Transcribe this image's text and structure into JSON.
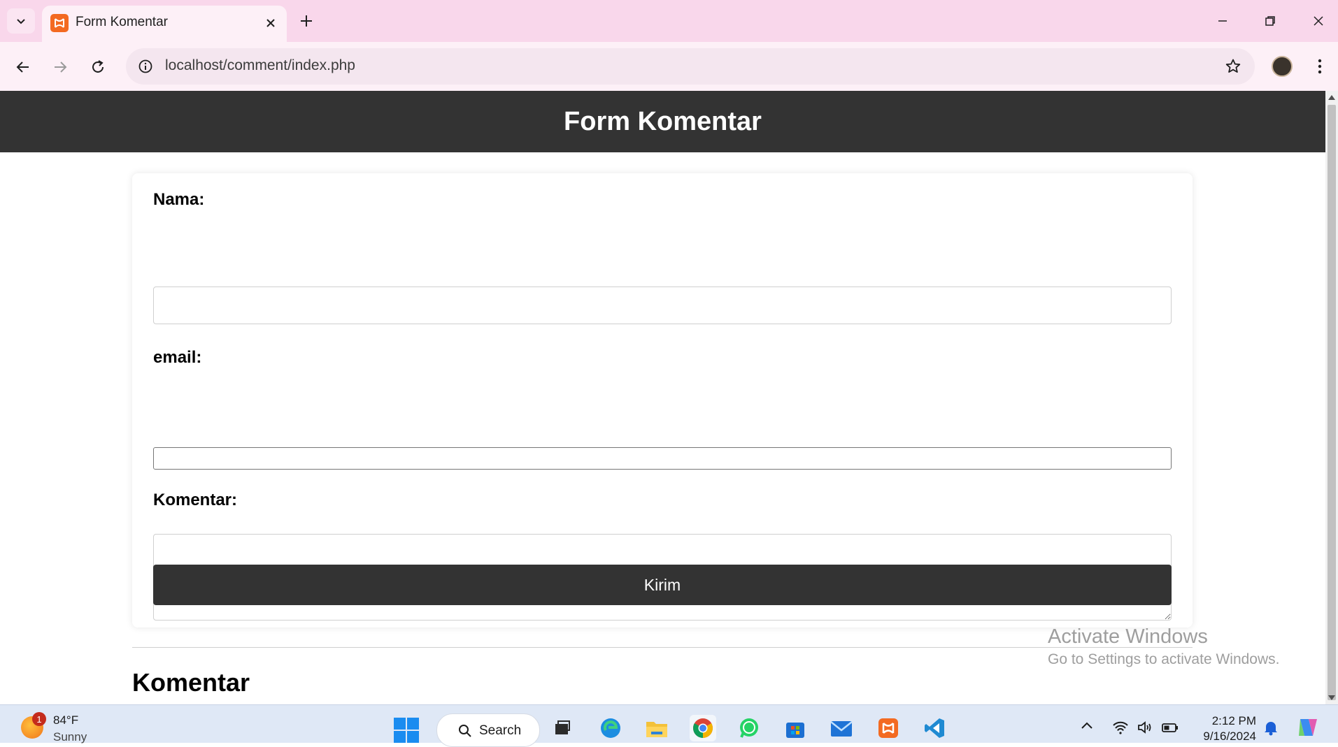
{
  "browser": {
    "tab_title": "Form Komentar",
    "url": "localhost/comment/index.php"
  },
  "page": {
    "header_title": "Form Komentar",
    "form": {
      "name_label": "Nama:",
      "name_value": "",
      "email_label": "email:",
      "email_value": "",
      "comment_label": "Komentar:",
      "comment_value": "",
      "submit_label": "Kirim"
    },
    "comments_section_title": "Komentar"
  },
  "watermark": {
    "line1": "Activate Windows",
    "line2": "Go to Settings to activate Windows."
  },
  "taskbar": {
    "weather_badge": "1",
    "weather_temp": "84°F",
    "weather_condition": "Sunny",
    "search_label": "Search",
    "apps": [
      "task-view",
      "edge",
      "file-explorer",
      "chrome",
      "whatsapp",
      "microsoft-store",
      "mail",
      "xampp",
      "vs-code"
    ],
    "time": "2:12 PM",
    "date": "9/16/2024"
  },
  "colors": {
    "tabstrip": "#f9d7eb",
    "toolbar": "#fdf0f7",
    "page_header": "#333333",
    "submit_button": "#333333",
    "taskbar": "#dfe8f6"
  }
}
